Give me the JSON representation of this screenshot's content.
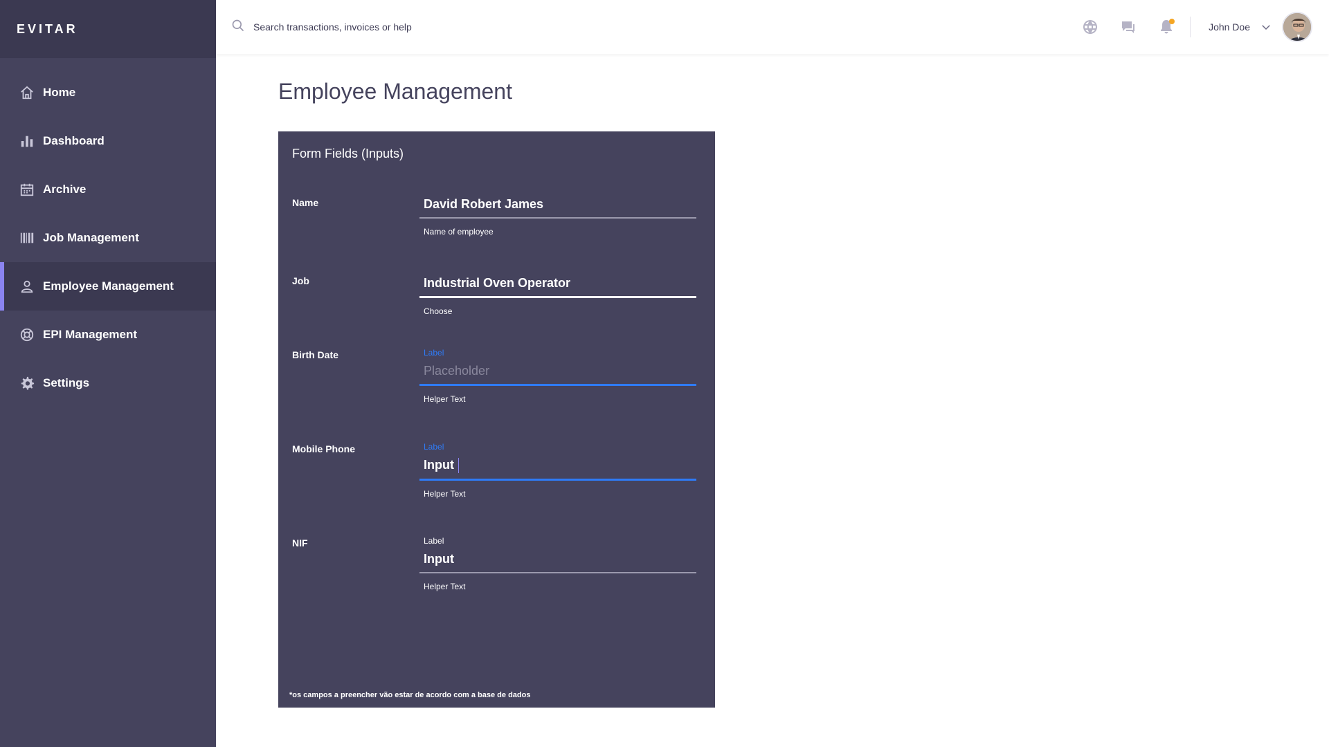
{
  "brand": "EVITAR",
  "sidebar": {
    "items": [
      {
        "label": "Home",
        "icon": "home-icon"
      },
      {
        "label": "Dashboard",
        "icon": "bar-chart-icon"
      },
      {
        "label": "Archive",
        "icon": "calendar-icon"
      },
      {
        "label": "Job Management",
        "icon": "barcode-icon"
      },
      {
        "label": "Employee Management",
        "icon": "user-icon"
      },
      {
        "label": "EPI Management",
        "icon": "lifebuoy-icon"
      },
      {
        "label": "Settings",
        "icon": "gear-icon"
      }
    ],
    "active_index": 4
  },
  "header": {
    "search_placeholder": "Search transactions, invoices or help",
    "icons": [
      "globe-icon",
      "chat-icon",
      "bell-icon"
    ],
    "username": "John Doe"
  },
  "main": {
    "page_title": "Employee Management",
    "card_title": "Form Fields (Inputs)",
    "fields": {
      "name": {
        "row_label": "Name",
        "value": "David Robert James",
        "helper": "Name of employee"
      },
      "job": {
        "row_label": "Job",
        "value": "Industrial Oven Operator",
        "helper": "Choose"
      },
      "birth_date": {
        "row_label": "Birth Date",
        "label": "Label",
        "placeholder": "Placeholder",
        "helper": "Helper Text"
      },
      "mobile_phone": {
        "row_label": "Mobile Phone",
        "label": "Label",
        "value": "Input",
        "helper": "Helper Text"
      },
      "nif": {
        "row_label": "NIF",
        "label": "Label",
        "value": "Input",
        "helper": "Helper Text"
      }
    },
    "footnote": "*os campos a preencher vão estar de acordo com a base de dados"
  },
  "colors": {
    "sidebar": "#45435d",
    "sidebar_dark": "#3b3951",
    "accent": "#8b84f0",
    "focus_blue": "#2f7bf6",
    "notification": "#f5a623"
  }
}
